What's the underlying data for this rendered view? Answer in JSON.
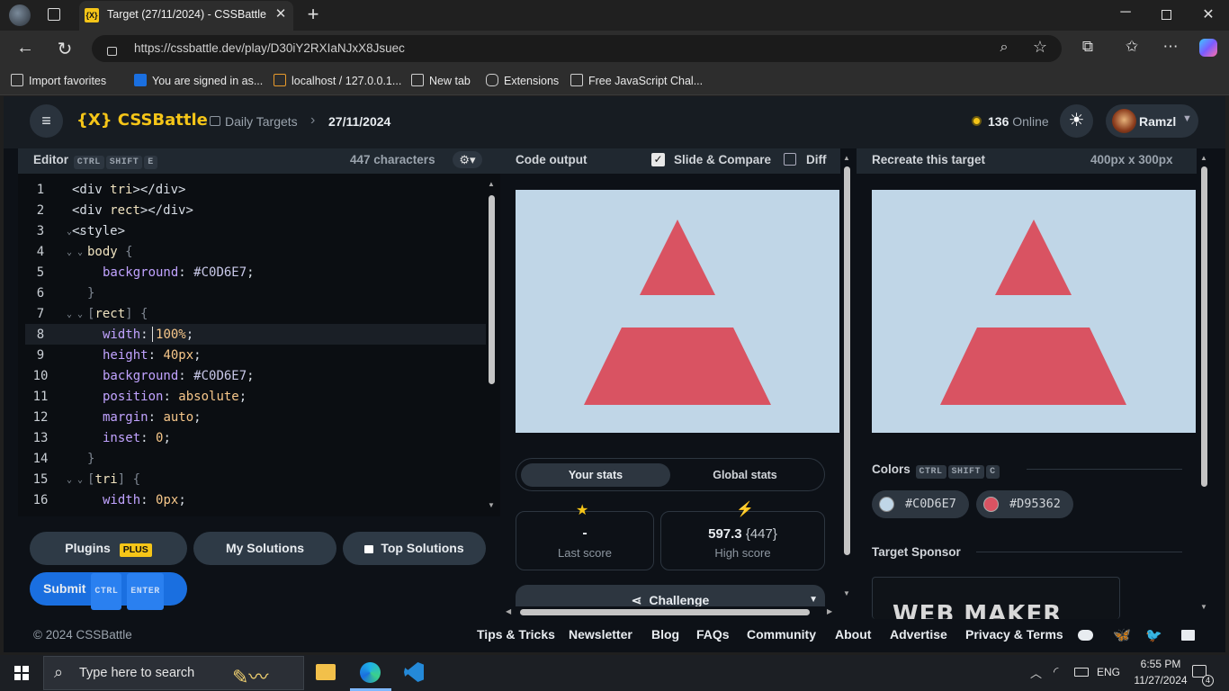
{
  "browser": {
    "tab_title": "Target (27/11/2024) - CSSBattle",
    "tab_favicon_text": "{X}",
    "url": "https://cssbattle.dev/play/D30iY2RXIaNJxX8Jsuec",
    "favorites": [
      "Import favorites",
      "You are signed in as...",
      "localhost / 127.0.0.1...",
      "New tab",
      "Extensions",
      "Free JavaScript Chal..."
    ]
  },
  "header": {
    "logo": "{X} CSSBattle",
    "breadcrumb_1": "Daily Targets",
    "breadcrumb_2": "27/11/2024",
    "online_count": "136",
    "online_label": "Online",
    "user": "Ramzl"
  },
  "editor": {
    "title": "Editor",
    "shortcut": [
      "CTRL",
      "SHIFT",
      "E"
    ],
    "char_count": "447 characters",
    "lines": [
      {
        "n": "1",
        "fold": "",
        "indent": 0,
        "parts": [
          [
            "tag",
            "<div "
          ],
          [
            "sel",
            "tri"
          ],
          [
            "tag",
            "></div>"
          ]
        ]
      },
      {
        "n": "2",
        "fold": "",
        "indent": 0,
        "parts": [
          [
            "tag",
            "<div "
          ],
          [
            "sel",
            "rect"
          ],
          [
            "tag",
            "></div>"
          ]
        ]
      },
      {
        "n": "3",
        "fold": "⌄ ⌄",
        "indent": 0,
        "parts": [
          [
            "tag",
            "<style>"
          ]
        ]
      },
      {
        "n": "4",
        "fold": "⌄ ⌄",
        "indent": 1,
        "parts": [
          [
            "sel",
            "body "
          ],
          [
            "brace",
            "{"
          ]
        ]
      },
      {
        "n": "5",
        "fold": "",
        "indent": 2,
        "parts": [
          [
            "prop",
            "background"
          ],
          [
            "tag",
            ": "
          ],
          [
            "hex",
            "#C0D6E7"
          ],
          [
            "tag",
            ";"
          ]
        ]
      },
      {
        "n": "6",
        "fold": "",
        "indent": 1,
        "parts": [
          [
            "brace",
            "}"
          ]
        ]
      },
      {
        "n": "7",
        "fold": "⌄ ⌄",
        "indent": 1,
        "parts": [
          [
            "brace",
            "["
          ],
          [
            "sel",
            "rect"
          ],
          [
            "brace",
            "] {"
          ]
        ]
      },
      {
        "n": "8",
        "fold": "",
        "indent": 2,
        "parts": [
          [
            "prop",
            "width"
          ],
          [
            "tag",
            ": "
          ],
          [
            "val",
            "100%"
          ],
          [
            "tag",
            ";"
          ]
        ]
      },
      {
        "n": "9",
        "fold": "",
        "indent": 2,
        "parts": [
          [
            "prop",
            "height"
          ],
          [
            "tag",
            ": "
          ],
          [
            "val",
            "40px"
          ],
          [
            "tag",
            ";"
          ]
        ]
      },
      {
        "n": "10",
        "fold": "",
        "indent": 2,
        "parts": [
          [
            "prop",
            "background"
          ],
          [
            "tag",
            ": "
          ],
          [
            "hex",
            "#C0D6E7"
          ],
          [
            "tag",
            ";"
          ]
        ]
      },
      {
        "n": "11",
        "fold": "",
        "indent": 2,
        "parts": [
          [
            "prop",
            "position"
          ],
          [
            "tag",
            ": "
          ],
          [
            "val",
            "absolute"
          ],
          [
            "tag",
            ";"
          ]
        ]
      },
      {
        "n": "12",
        "fold": "",
        "indent": 2,
        "parts": [
          [
            "prop",
            "margin"
          ],
          [
            "tag",
            ": "
          ],
          [
            "val",
            "auto"
          ],
          [
            "tag",
            ";"
          ]
        ]
      },
      {
        "n": "13",
        "fold": "",
        "indent": 2,
        "parts": [
          [
            "prop",
            "inset"
          ],
          [
            "tag",
            ": "
          ],
          [
            "val",
            "0"
          ],
          [
            "tag",
            ";"
          ]
        ]
      },
      {
        "n": "14",
        "fold": "",
        "indent": 1,
        "parts": [
          [
            "brace",
            "}"
          ]
        ]
      },
      {
        "n": "15",
        "fold": "⌄ ⌄",
        "indent": 1,
        "parts": [
          [
            "brace",
            "["
          ],
          [
            "sel",
            "tri"
          ],
          [
            "brace",
            "] {"
          ]
        ]
      },
      {
        "n": "16",
        "fold": "",
        "indent": 2,
        "parts": [
          [
            "prop",
            "width"
          ],
          [
            "tag",
            ": "
          ],
          [
            "val",
            "0px"
          ],
          [
            "tag",
            ";"
          ]
        ]
      }
    ]
  },
  "buttons": {
    "plugins": "Plugins",
    "plus_badge": "PLUS",
    "my_solutions": "My Solutions",
    "top_solutions": "Top Solutions",
    "submit": "Submit",
    "submit_keys": [
      "CTRL",
      "ENTER"
    ]
  },
  "output": {
    "title": "Code output",
    "slide_compare": "Slide & Compare",
    "diff": "Diff",
    "slide_checked": true,
    "diff_checked": false,
    "tab_your": "Your stats",
    "tab_global": "Global stats",
    "last_score": "-",
    "last_label": "Last score",
    "high_score": "597.3",
    "high_chars": "{447}",
    "high_label": "High score",
    "challenge": "Challenge"
  },
  "target": {
    "title": "Recreate this target",
    "size": "400px x 300px",
    "colors_label": "Colors",
    "colors_keys": [
      "CTRL",
      "SHIFT",
      "C"
    ],
    "colors": [
      {
        "hex": "#C0D6E7",
        "label": "#C0D6E7"
      },
      {
        "hex": "#D95362",
        "label": "#D95362"
      }
    ],
    "sponsor_label": "Target Sponsor",
    "sponsor_text": "WEB MAKER"
  },
  "footer": {
    "copyright": "© 2024 CSSBattle",
    "links": [
      "Tips & Tricks",
      "Newsletter",
      "Blog",
      "FAQs",
      "Community",
      "About",
      "Advertise",
      "Privacy & Terms"
    ]
  },
  "taskbar": {
    "search": "Type here to search",
    "time": "6:55 PM",
    "date": "11/27/2024",
    "lang": "ENG",
    "notif_count": "4"
  },
  "colors": {
    "bg": "#C0D6E7",
    "shape": "#D95362",
    "accent_blue": "#1a6fe0",
    "plus_yellow": "#f5c518"
  }
}
